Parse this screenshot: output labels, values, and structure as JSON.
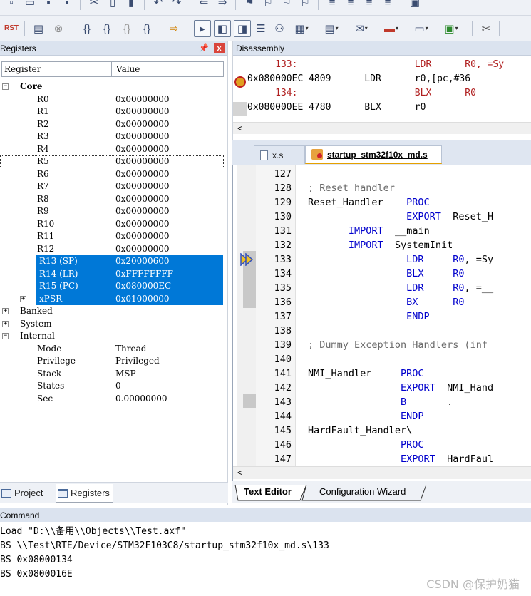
{
  "registers_panel": {
    "title": "Registers",
    "pin_icon": "pin-icon",
    "close_label": "x",
    "columns": {
      "register": "Register",
      "value": "Value"
    },
    "core": {
      "label": "Core",
      "rows": [
        {
          "name": "R0",
          "value": "0x00000000"
        },
        {
          "name": "R1",
          "value": "0x00000000"
        },
        {
          "name": "R2",
          "value": "0x00000000"
        },
        {
          "name": "R3",
          "value": "0x00000000"
        },
        {
          "name": "R4",
          "value": "0x00000000"
        },
        {
          "name": "R5",
          "value": "0x00000000"
        },
        {
          "name": "R6",
          "value": "0x00000000"
        },
        {
          "name": "R7",
          "value": "0x00000000"
        },
        {
          "name": "R8",
          "value": "0x00000000"
        },
        {
          "name": "R9",
          "value": "0x00000000"
        },
        {
          "name": "R10",
          "value": "0x00000000"
        },
        {
          "name": "R11",
          "value": "0x00000000"
        },
        {
          "name": "R12",
          "value": "0x00000000"
        },
        {
          "name": "R13 (SP)",
          "value": "0x20000600"
        },
        {
          "name": "R14 (LR)",
          "value": "0xFFFFFFFF"
        },
        {
          "name": "R15 (PC)",
          "value": "0x080000EC"
        },
        {
          "name": "xPSR",
          "value": "0x01000000"
        }
      ]
    },
    "groups": {
      "banked": "Banked",
      "system": "System",
      "internal": "Internal"
    },
    "internal_rows": [
      {
        "name": "Mode",
        "value": "Thread"
      },
      {
        "name": "Privilege",
        "value": "Privileged"
      },
      {
        "name": "Stack",
        "value": "MSP"
      },
      {
        "name": "States",
        "value": "0"
      },
      {
        "name": "Sec",
        "value": "0.00000000"
      }
    ],
    "tabs": {
      "project": "Project",
      "registers": "Registers"
    }
  },
  "disassembly": {
    "title": "Disassembly",
    "lines": [
      {
        "text": "     133:                     LDR      R0, =Sy",
        "gray": false
      },
      {
        "text": "0x080000EC 4809      LDR      r0,[pc,#36",
        "gray": false
      },
      {
        "text": "     134:                     BLX      R0",
        "gray": false
      },
      {
        "text": "0x080000EE 4780      BLX      r0",
        "gray": true
      }
    ],
    "scroll_left": "<"
  },
  "editor": {
    "tabs": {
      "inactive": "x.s",
      "active": "startup_stm32f10x_md.s"
    },
    "lines": [
      {
        "n": "127",
        "code": ""
      },
      {
        "n": "128",
        "code": "; Reset handler"
      },
      {
        "n": "129",
        "code": "Reset_Handler    PROC"
      },
      {
        "n": "130",
        "code": "                 EXPORT  Reset_H"
      },
      {
        "n": "131",
        "code": "       IMPORT  __main"
      },
      {
        "n": "132",
        "code": "       IMPORT  SystemInit"
      },
      {
        "n": "133",
        "code": "                 LDR     R0, =Sy"
      },
      {
        "n": "134",
        "code": "                 BLX     R0"
      },
      {
        "n": "135",
        "code": "                 LDR     R0, =__"
      },
      {
        "n": "136",
        "code": "                 BX      R0"
      },
      {
        "n": "137",
        "code": "                 ENDP"
      },
      {
        "n": "138",
        "code": ""
      },
      {
        "n": "139",
        "code": "; Dummy Exception Handlers (inf"
      },
      {
        "n": "140",
        "code": ""
      },
      {
        "n": "141",
        "code": "NMI_Handler     PROC"
      },
      {
        "n": "142",
        "code": "                EXPORT  NMI_Hand"
      },
      {
        "n": "143",
        "code": "                B       ."
      },
      {
        "n": "144",
        "code": "                ENDP"
      },
      {
        "n": "145",
        "code": "HardFault_Handler\\"
      },
      {
        "n": "146",
        "code": "                PROC"
      },
      {
        "n": "147",
        "code": "                EXPORT  HardFaul"
      }
    ],
    "bottom_tabs": {
      "text_editor": "Text Editor",
      "config_wizard": "Configuration Wizard"
    },
    "scroll_left": "<"
  },
  "command": {
    "title": "Command",
    "lines": [
      "Load \"D:\\\\备用\\\\Objects\\\\Test.axf\"",
      "BS \\\\Test\\RTE/Device/STM32F103C8/startup_stm32f10x_md.s\\133",
      "BS 0x08000134",
      "BS 0x0800016E"
    ]
  },
  "watermark": "CSDN @保护奶猫",
  "colors": {
    "selection": "#0078d7",
    "keyword": "#0000cc",
    "comment": "#6a6a6a",
    "close": "#d9453c"
  }
}
